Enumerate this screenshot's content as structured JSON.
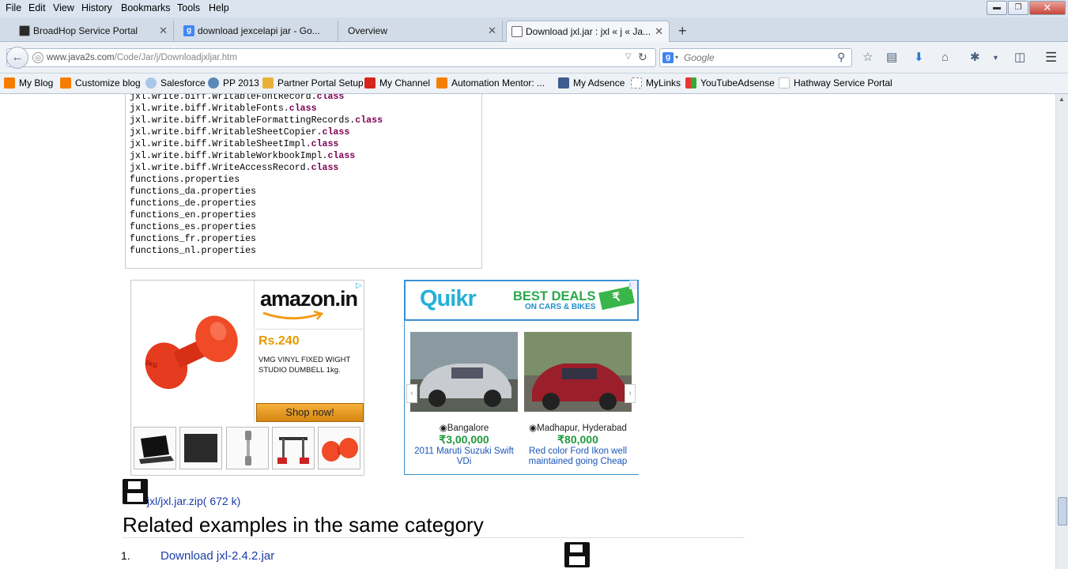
{
  "menu": [
    "File",
    "Edit",
    "View",
    "History",
    "Bookmarks",
    "Tools",
    "Help"
  ],
  "tabs": [
    {
      "label": "BroadHop Service Portal",
      "color": "#2a2a2a"
    },
    {
      "label": "download jexcelapi jar - Go...",
      "color": "#4285f4"
    },
    {
      "label": "Overview",
      "color": ""
    },
    {
      "label": "Download jxl.jar : jxl « j « Ja...",
      "color": "#777"
    }
  ],
  "new_tab_symbol": "+",
  "url": {
    "host": "www.java2s.com",
    "path": "/Code/Jar/j/Downloadjxljar.htm"
  },
  "search_placeholder": "Google",
  "bookmarks": [
    {
      "label": "My Blog",
      "color": "#f57d00"
    },
    {
      "label": "Customize blog",
      "color": "#f57d00"
    },
    {
      "label": "Salesforce",
      "color": "#a9c7e8"
    },
    {
      "label": "PP 2013",
      "color": "#5a8ab8"
    },
    {
      "label": "Partner Portal Setup",
      "color": "#e8b23a"
    },
    {
      "label": "My Channel",
      "color": "#d6251a"
    },
    {
      "label": "Automation Mentor: ...",
      "color": "#f57d00"
    },
    {
      "label": "My Adsence",
      "color": "#3c5b8e"
    },
    {
      "label": "MyLinks",
      "color": "#ffffff"
    },
    {
      "label": "YouTubeAdsense",
      "color": "#3a9a3a"
    },
    {
      "label": "Hathway Service Portal",
      "color": "#888888"
    }
  ],
  "code_lines": [
    {
      "text": "jxl.write.biff.WritableFontRecord.",
      "kw": "class"
    },
    {
      "text": "jxl.write.biff.WritableFonts.",
      "kw": "class"
    },
    {
      "text": "jxl.write.biff.WritableFormattingRecords.",
      "kw": "class"
    },
    {
      "text": "jxl.write.biff.WritableSheetCopier.",
      "kw": "class"
    },
    {
      "text": "jxl.write.biff.WritableSheetImpl.",
      "kw": "class"
    },
    {
      "text": "jxl.write.biff.WritableWorkbookImpl.",
      "kw": "class"
    },
    {
      "text": "jxl.write.biff.WriteAccessRecord.",
      "kw": "class"
    },
    {
      "text": "functions.properties",
      "kw": ""
    },
    {
      "text": "functions_da.properties",
      "kw": ""
    },
    {
      "text": "functions_de.properties",
      "kw": ""
    },
    {
      "text": "functions_en.properties",
      "kw": ""
    },
    {
      "text": "functions_es.properties",
      "kw": ""
    },
    {
      "text": "functions_fr.properties",
      "kw": ""
    },
    {
      "text": "functions_nl.properties",
      "kw": ""
    }
  ],
  "amazon_ad": {
    "brand": "amazon.in",
    "price": "Rs.240",
    "product": "VMG VINYL FIXED WIGHT STUDIO DUMBELL 1kg.",
    "cta": "Shop now!",
    "dumbbell_text": "1KG"
  },
  "quikr_ad": {
    "brand": "Quikr",
    "banner_line1": "BEST DEALS",
    "banner_line2": "ON CARS & BIKES",
    "banner_symbol": "₹",
    "items": [
      {
        "location": "Bangalore",
        "price": "₹3,00,000",
        "title": "2011 Maruti Suzuki Swift VDi"
      },
      {
        "location": "Madhapur, Hyderabad",
        "price": "₹80,000",
        "title": "Red color Ford Ikon well maintained going Cheap"
      }
    ]
  },
  "download": {
    "link": "jxl/jxl.jar.zip",
    "size": "( 672 k)"
  },
  "related": {
    "heading": "Related examples in the same category",
    "items": [
      {
        "num": "1.",
        "label": "Download jxl-2.4.2.jar"
      }
    ]
  }
}
